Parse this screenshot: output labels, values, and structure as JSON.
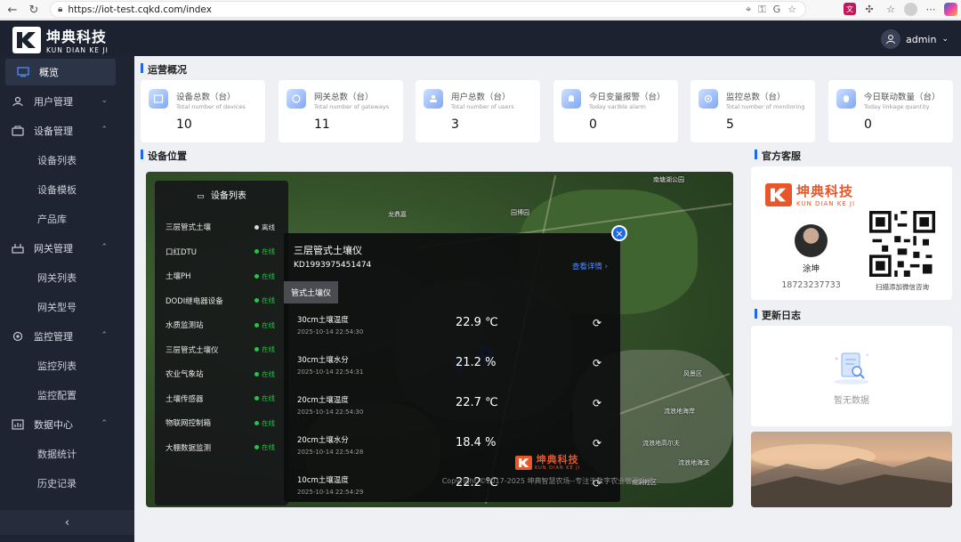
{
  "browser": {
    "url": "https://iot-test.cqkd.com/index"
  },
  "header": {
    "logo_name": "坤典科技",
    "logo_sub": "KUN DIAN KE JI",
    "user": "admin"
  },
  "sidebar": {
    "items": [
      {
        "label": "概览"
      },
      {
        "label": "用户管理"
      },
      {
        "label": "设备管理"
      },
      {
        "label": "设备列表"
      },
      {
        "label": "设备模板"
      },
      {
        "label": "产品库"
      },
      {
        "label": "网关管理"
      },
      {
        "label": "网关列表"
      },
      {
        "label": "网关型号"
      },
      {
        "label": "监控管理"
      },
      {
        "label": "监控列表"
      },
      {
        "label": "监控配置"
      },
      {
        "label": "数据中心"
      },
      {
        "label": "数据统计"
      },
      {
        "label": "历史记录"
      }
    ]
  },
  "overview": {
    "title": "运营概况",
    "stats": [
      {
        "label": "设备总数（台）",
        "sub": "Total number of devices",
        "value": "10"
      },
      {
        "label": "网关总数（台）",
        "sub": "Total number of gateways",
        "value": "11"
      },
      {
        "label": "用户总数（台）",
        "sub": "Total number of users",
        "value": "3"
      },
      {
        "label": "今日变量报警（台）",
        "sub": "Today varible alarm",
        "value": "0"
      },
      {
        "label": "监控总数（台）",
        "sub": "Total number of monitoring",
        "value": "5"
      },
      {
        "label": "今日联动数量（台）",
        "sub": "Today linkage quantity",
        "value": "0"
      }
    ]
  },
  "map_section": {
    "title": "设备位置",
    "map_labels": [
      "南塘湖公园",
      "园博园",
      "龙鼎嘉",
      "风景区",
      "流浪地海岸",
      "流浪地高尔夫",
      "流浪地海滨",
      "南洞社区"
    ],
    "device_list": {
      "title": "设备列表",
      "items": [
        {
          "name": "三层管式土壤",
          "status": "离线",
          "color": "#d9d9d9"
        },
        {
          "name": "口红DTU",
          "status": "在线",
          "color": "#27c24c"
        },
        {
          "name": "土壤PH",
          "status": "在线",
          "color": "#27c24c"
        },
        {
          "name": "DODI继电器设备",
          "status": "在线",
          "color": "#27c24c"
        },
        {
          "name": "水质监测站",
          "status": "在线",
          "color": "#27c24c"
        },
        {
          "name": "三层管式土壤仪",
          "status": "在线",
          "color": "#27c24c"
        },
        {
          "name": "农业气象站",
          "status": "在线",
          "color": "#27c24c"
        },
        {
          "name": "土壤传感器",
          "status": "在线",
          "color": "#27c24c"
        },
        {
          "name": "物联网控制箱",
          "status": "在线",
          "color": "#27c24c"
        },
        {
          "name": "大棚数据监测",
          "status": "在线",
          "color": "#27c24c"
        }
      ]
    },
    "popup": {
      "title": "三层管式土壤仪",
      "device_id": "KD1993975451474",
      "detail_link": "查看详情 ›",
      "tab": "管式土壤仪",
      "readings": [
        {
          "name": "30cm土壤温度",
          "time": "2025-10-14 22:54:30",
          "value": "22.9 ℃"
        },
        {
          "name": "30cm土壤水分",
          "time": "2025-10-14 22:54:31",
          "value": "21.2 %"
        },
        {
          "name": "20cm土壤温度",
          "time": "2025-10-14 22:54:30",
          "value": "22.7 ℃"
        },
        {
          "name": "20cm土壤水分",
          "time": "2025-10-14 22:54:28",
          "value": "18.4 %"
        },
        {
          "name": "10cm土壤温度",
          "time": "2025-10-14 22:54:29",
          "value": "22.2 ℃"
        }
      ]
    }
  },
  "service": {
    "title": "官方客服",
    "brand": "坤典科技",
    "brand_sub": "KUN DIAN KE JI",
    "contact_name": "涂坤",
    "phone": "18723237733",
    "qr_caption": "扫描添加微信咨询"
  },
  "changelog": {
    "title": "更新日志",
    "empty_text": "暂无数据"
  },
  "footer": {
    "brand": "坤典科技",
    "brand_sub": "KUN DIAN KE JI",
    "copyright": "Copyright ©2017-2025 坤典智慧农场--专注于数字农业管理系统"
  },
  "colors": {
    "accent": "#1d6ae5",
    "sidebar_bg": "#1f2433",
    "online": "#27c24c",
    "brand": "#e8572a"
  }
}
